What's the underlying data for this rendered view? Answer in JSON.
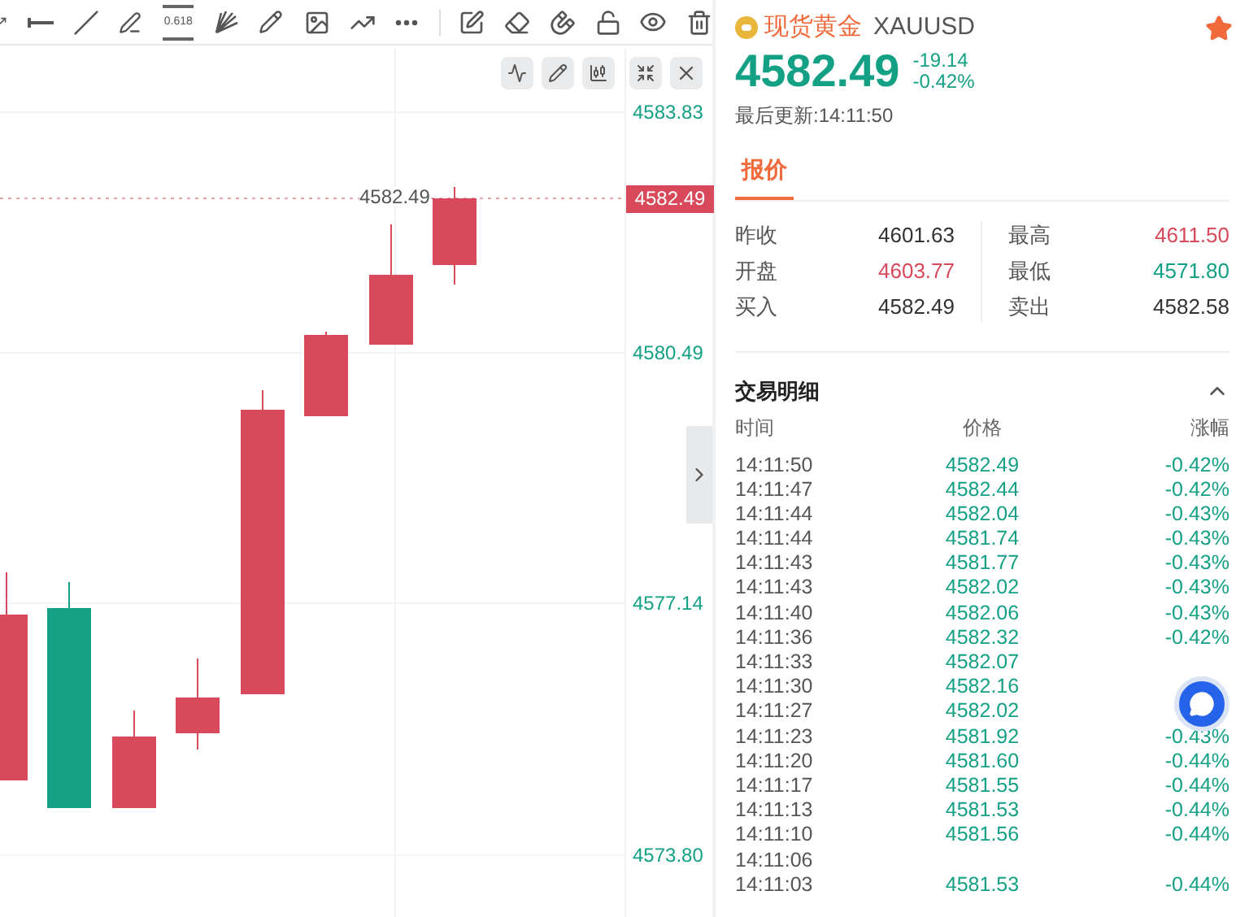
{
  "toolbar": {
    "fib_label": "0.618"
  },
  "chart": {
    "axis_ticks": [
      "4583.83",
      "4580.49",
      "4577.14",
      "4573.80"
    ],
    "current_price": "4582.49",
    "last_label": "4582.49"
  },
  "instrument": {
    "name": "现货黄金",
    "symbol": "XAUUSD",
    "favorite": true,
    "price": "4582.49",
    "change": "-19.14",
    "change_percent": "-0.42%",
    "updated": "最后更新:14:11:50"
  },
  "tabs": [
    {
      "label": "报价",
      "selected": true
    }
  ],
  "stats": [
    {
      "label": "昨收",
      "value": "4601.63",
      "color": "#333333"
    },
    {
      "label": "最高",
      "value": "4611.50",
      "color": "#d84a5b"
    },
    {
      "label": "开盘",
      "value": "4603.77",
      "color": "#d84a5b"
    },
    {
      "label": "最低",
      "value": "4571.80",
      "color": "#14a085"
    },
    {
      "label": "买入",
      "value": "4582.49",
      "color": "#333333"
    },
    {
      "label": "卖出",
      "value": "4582.58",
      "color": "#333333"
    }
  ],
  "trades": {
    "title": "交易明细",
    "expanded": true,
    "columns": [
      "时间",
      "价格",
      "涨幅"
    ],
    "rows": [
      {
        "time": "14:11:50",
        "price": "4582.49",
        "change": "-0.42%"
      },
      {
        "time": "14:11:47",
        "price": "4582.44",
        "change": "-0.42%"
      },
      {
        "time": "14:11:44",
        "price": "4582.04",
        "change": "-0.43%"
      },
      {
        "time": "14:11:44",
        "price": "4581.74",
        "change": "-0.43%"
      },
      {
        "time": "14:11:43",
        "price": "4581.77",
        "change": "-0.43%"
      },
      {
        "time": "14:11:43",
        "price": "4582.02",
        "change": "-0.43%"
      },
      {
        "time": "14:11:40",
        "price": "4582.06",
        "change": "-0.43%"
      },
      {
        "time": "14:11:36",
        "price": "4582.32",
        "change": "-0.42%"
      },
      {
        "time": "14:11:33",
        "price": "4582.07"
      },
      {
        "time": "14:11:30",
        "price": "4582.16"
      },
      {
        "time": "14:11:27",
        "price": "4582.02"
      },
      {
        "time": "14:11:23",
        "price": "4581.92",
        "change": "-0.43%"
      },
      {
        "time": "14:11:20",
        "price": "4581.60",
        "change": "-0.44%"
      },
      {
        "time": "14:11:17",
        "price": "4581.55",
        "change": "-0.44%"
      },
      {
        "time": "14:11:13",
        "price": "4581.53",
        "change": "-0.44%"
      },
      {
        "time": "14:11:10",
        "price": "4581.56",
        "change": "-0.44%"
      },
      {
        "time": "14:11:06"
      },
      {
        "time": "14:11:03",
        "price": "4581.53",
        "change": "-0.44%"
      }
    ]
  }
}
